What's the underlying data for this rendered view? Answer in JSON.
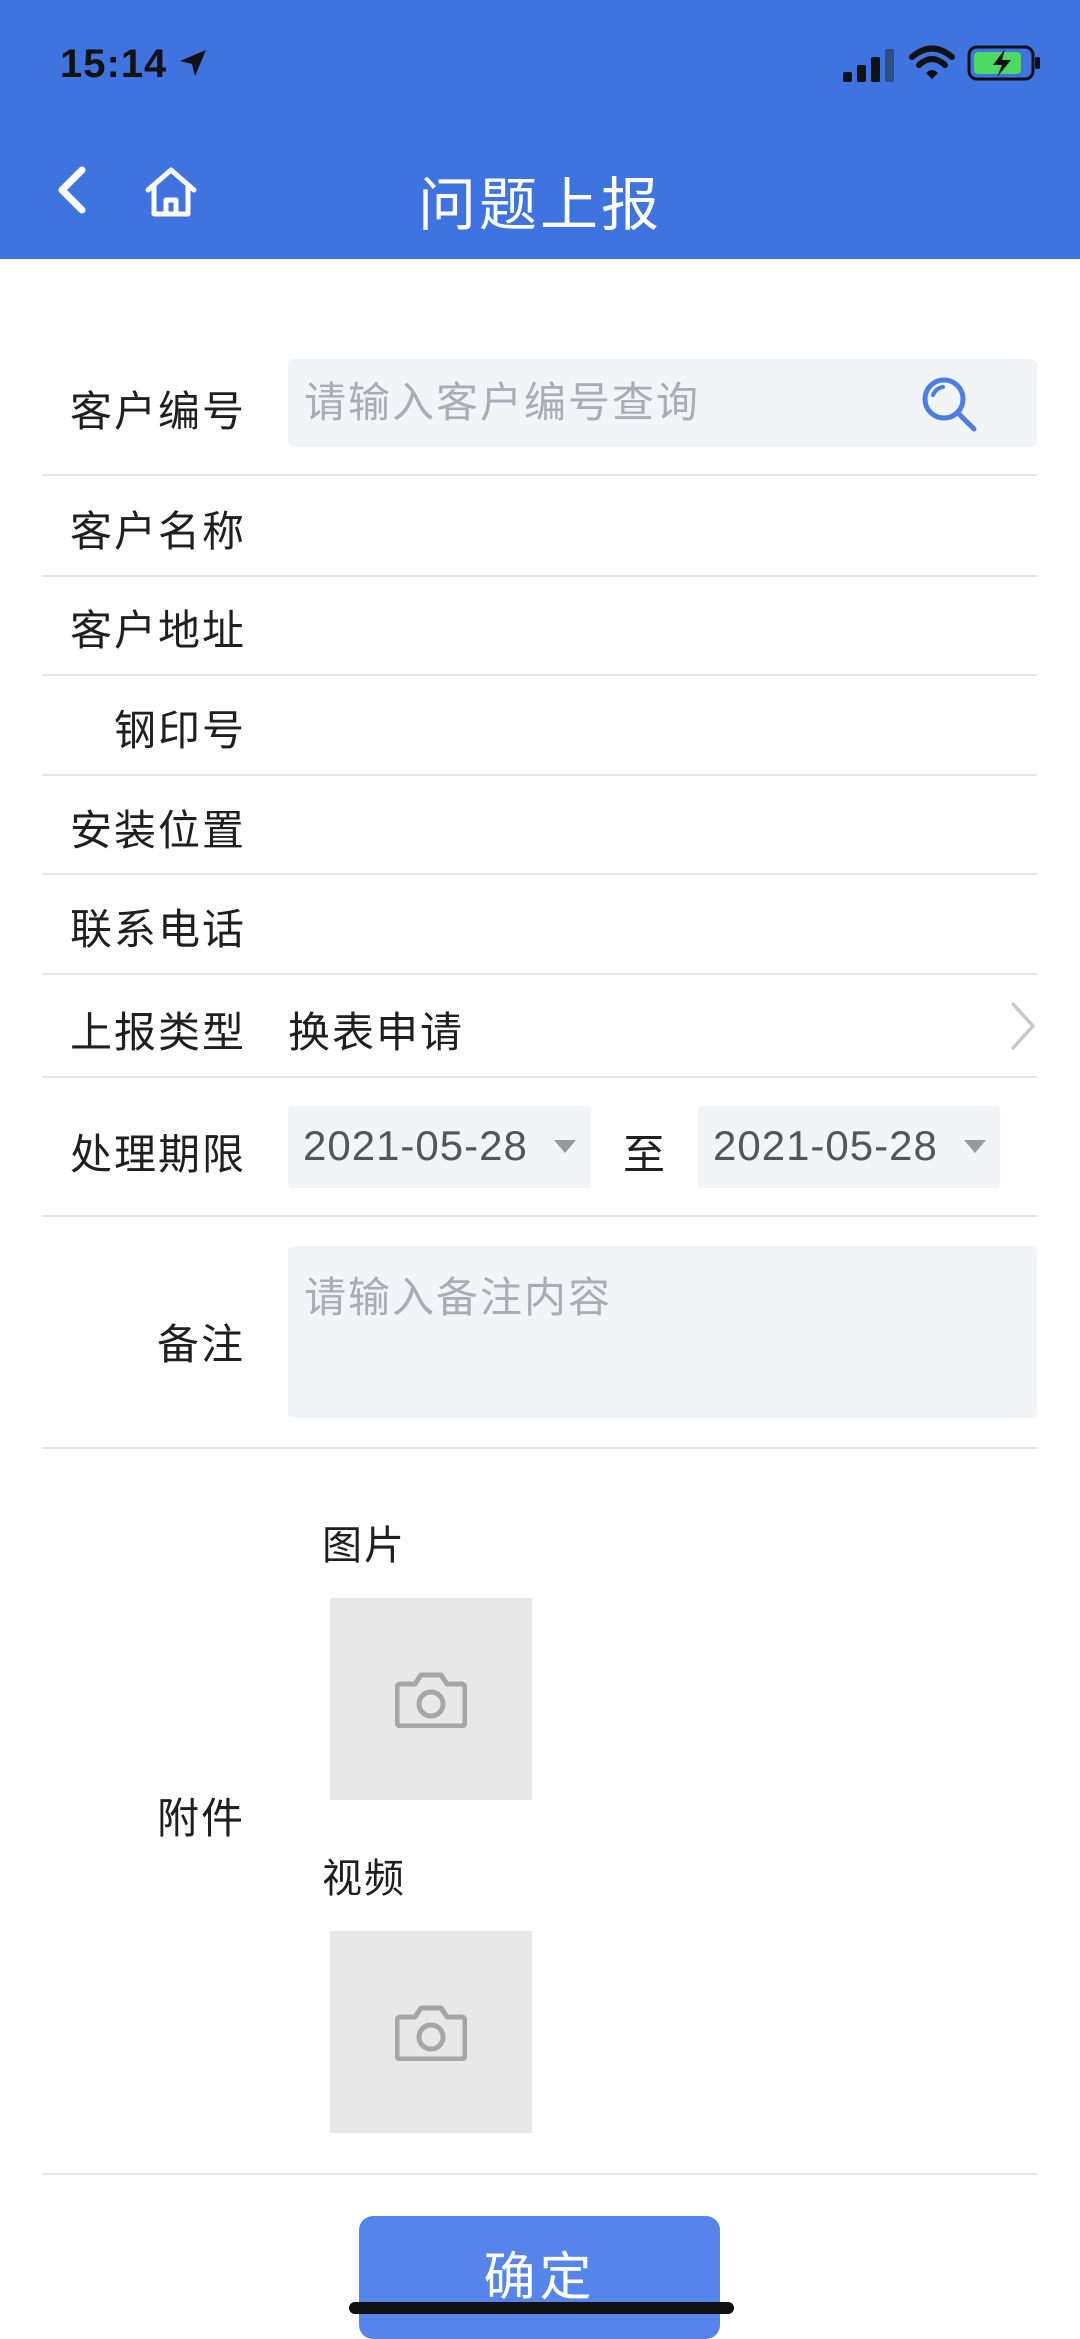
{
  "status_bar": {
    "time": "15:14"
  },
  "header": {
    "title": "问题上报"
  },
  "form": {
    "customer_no": {
      "label": "客户编号",
      "placeholder": "请输入客户编号查询",
      "value": ""
    },
    "customer_name": {
      "label": "客户名称",
      "value": ""
    },
    "customer_address": {
      "label": "客户地址",
      "value": ""
    },
    "seal_no": {
      "label": "钢印号",
      "value": ""
    },
    "install_location": {
      "label": "安装位置",
      "value": ""
    },
    "phone": {
      "label": "联系电话",
      "value": ""
    },
    "report_type": {
      "label": "上报类型",
      "value": "换表申请"
    },
    "deadline": {
      "label": "处理期限",
      "start": "2021-05-28",
      "to": "至",
      "end": "2021-05-28"
    },
    "remark": {
      "label": "备注",
      "placeholder": "请输入备注内容",
      "value": ""
    },
    "attachment": {
      "label": "附件",
      "image_label": "图片",
      "video_label": "视频"
    }
  },
  "actions": {
    "confirm_label": "确定"
  },
  "icons": {
    "back": "chevron-left-icon",
    "home": "home-icon",
    "search": "search-icon",
    "camera": "camera-icon",
    "chevron_right": "chevron-right-icon"
  },
  "colors": {
    "primary": "#3f73e0",
    "button": "#5585ea",
    "field_bg": "#f2f4f8",
    "upload_bg": "#e8e8e8"
  }
}
